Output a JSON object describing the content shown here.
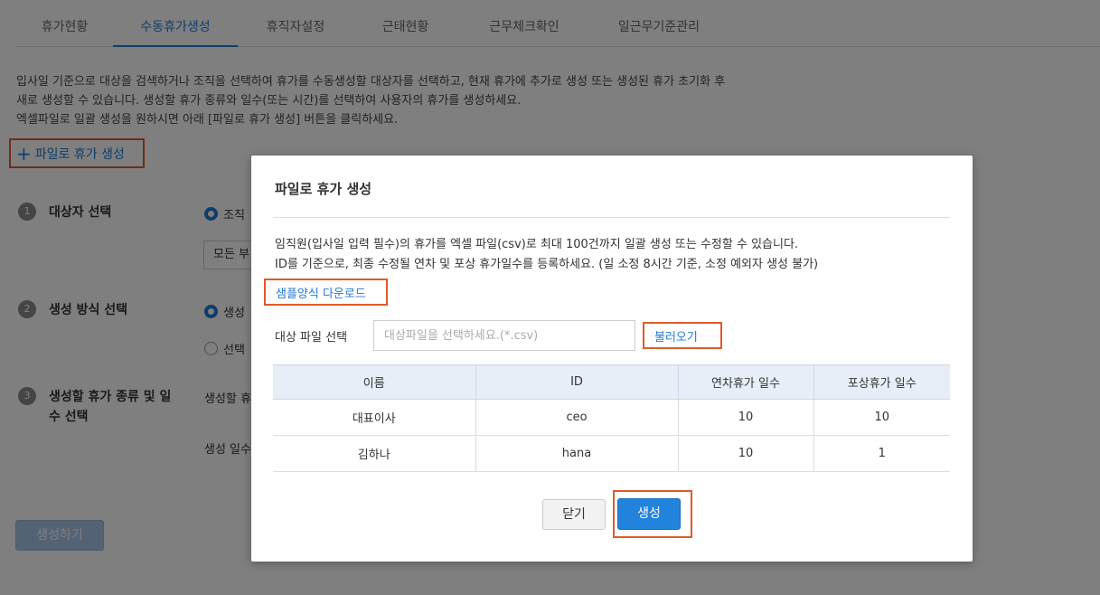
{
  "tabs": [
    {
      "label": "휴가현황",
      "active": false
    },
    {
      "label": "수동휴가생성",
      "active": true
    },
    {
      "label": "휴직자설정",
      "active": false
    },
    {
      "label": "근태현황",
      "active": false
    },
    {
      "label": "근무체크확인",
      "active": false
    },
    {
      "label": "일근무기준관리",
      "active": false
    }
  ],
  "description": [
    "입사일 기준으로 대상을 검색하거나 조직을 선택하여 휴가를 수동생성할 대상자를 선택하고, 현재 휴가에 추가로 생성 또는 생성된 휴가 초기화 후",
    "새로 생성할 수 있습니다. 생성할 휴가 종류와 일수(또는 시간)를 선택하여 사용자의 휴가를 생성하세요.",
    "엑셀파일로 일괄 생성을 원하시면 아래 [파일로 휴가 생성] 버튼을 클릭하세요."
  ],
  "file_create_link": {
    "icon": "plus-icon",
    "label": "파일로 휴가 생성"
  },
  "steps": [
    {
      "num": "1",
      "title": "대상자 선택"
    },
    {
      "num": "2",
      "title": "생성 방식 선택"
    },
    {
      "num": "3",
      "title_line1": "생성할 휴가 종류 및 일",
      "title_line2": "수 선택"
    }
  ],
  "step1": {
    "radio_label": "조직",
    "select_value": "모든 부"
  },
  "step2": {
    "radio1_label": "생성",
    "radio2_label": "선택"
  },
  "step3": {
    "type_label": "생성할 휴",
    "days_label": "생성 일수"
  },
  "submit_label": "생성하기",
  "modal": {
    "title": "파일로 휴가 생성",
    "desc": [
      "임직원(입사일 입력 필수)의 휴가를 엑셀 파일(csv)로 최대 100건까지 일괄 생성 또는 수정할 수 있습니다.",
      "ID를 기준으로, 최종 수정될 연차 및 포상 휴가일수를 등록하세요. (일 소정 8시간 기준, 소정 예외자 생성 불가)"
    ],
    "sample_download": "샘플양식 다운로드",
    "file_label": "대상 파일 선택",
    "file_placeholder": "대상파일을 선택하세요.(*.csv)",
    "load_button": "불러오기",
    "table": {
      "headers": [
        "이름",
        "ID",
        "연차휴가 일수",
        "포상휴가 일수"
      ],
      "rows": [
        [
          "대표이사",
          "ceo",
          "10",
          "10"
        ],
        [
          "김하나",
          "hana",
          "10",
          "1"
        ]
      ]
    },
    "close_button": "닫기",
    "create_button": "생성"
  },
  "colors": {
    "accent": "#1f7ad6",
    "highlight": "#e05a2b",
    "primary_button": "#2283dc"
  }
}
